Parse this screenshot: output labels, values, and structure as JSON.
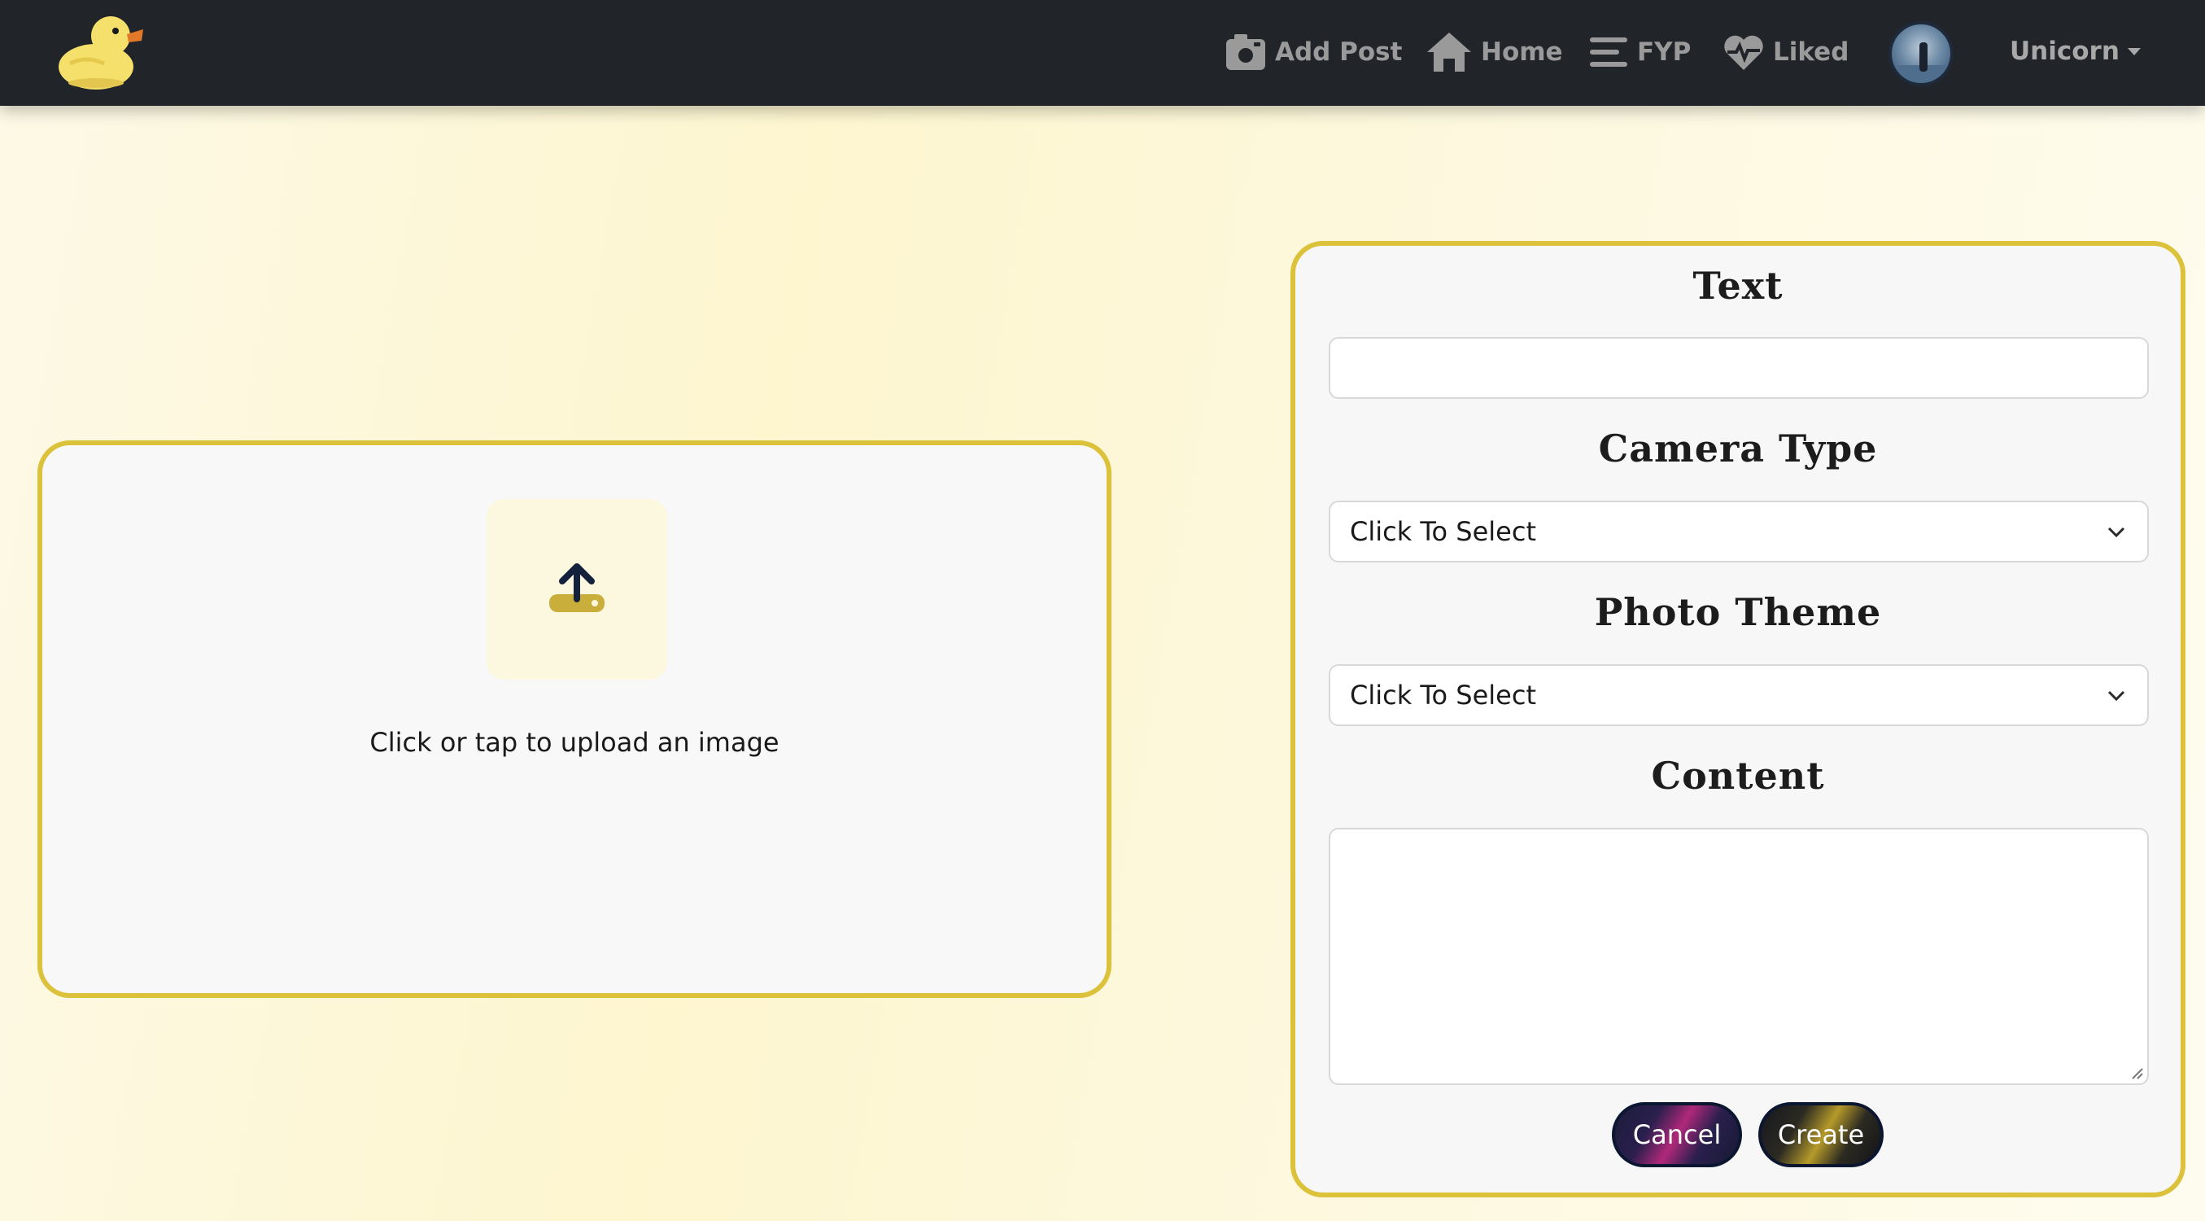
{
  "nav": {
    "logo_icon": "duck-logo-icon",
    "items": [
      {
        "label": "Add Post",
        "icon": "camera-plus-icon"
      },
      {
        "label": "Home",
        "icon": "home-icon"
      },
      {
        "label": "FYP",
        "icon": "bars-icon"
      },
      {
        "label": "Liked",
        "icon": "heart-pulse-icon"
      }
    ],
    "username": "Unicorn"
  },
  "upload": {
    "icon": "upload-icon",
    "prompt": "Click or tap to upload an image"
  },
  "form": {
    "text_label": "Text",
    "text_value": "",
    "camera_label": "Camera Type",
    "camera_value": "Click To Select",
    "theme_label": "Photo Theme",
    "theme_value": "Click To Select",
    "content_label": "Content",
    "content_value": "",
    "cancel_label": "Cancel",
    "create_label": "Create"
  },
  "colors": {
    "navbar": "#212529",
    "accent_border": "#dcc13a",
    "nav_text": "#9a9a9a",
    "page_bg": "#fdf8dd"
  }
}
